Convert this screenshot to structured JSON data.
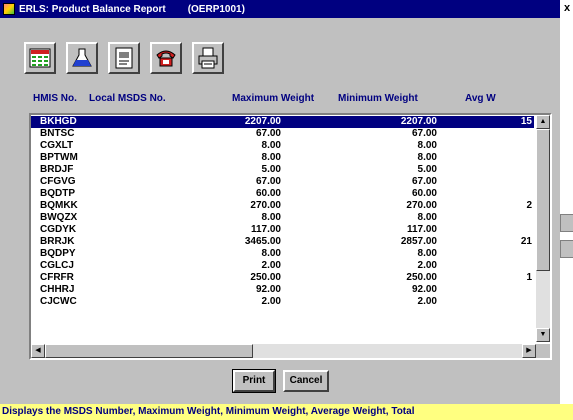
{
  "window": {
    "title": "ERLS: Product Balance Report",
    "code": "(OERP1001)",
    "close_glyph": "x"
  },
  "toolbar": {
    "buttons": [
      {
        "name": "spreadsheet-icon",
        "color": "#d02020"
      },
      {
        "name": "flask-icon",
        "color": "#2040d0"
      },
      {
        "name": "document-icon",
        "color": "#808080"
      },
      {
        "name": "telephone-icon",
        "color": "#d02020"
      },
      {
        "name": "printer-icon",
        "color": "#808080"
      }
    ]
  },
  "columns": [
    "HMIS No.",
    "Local MSDS No.",
    "Maximum Weight",
    "Minimum Weight",
    "Avg W"
  ],
  "rows": [
    {
      "id": "BKHGD",
      "max": "2207.00",
      "min": "2207.00",
      "avg": "15",
      "selected": true
    },
    {
      "id": "BNTSC",
      "max": "67.00",
      "min": "67.00",
      "avg": ""
    },
    {
      "id": "CGXLT",
      "max": "8.00",
      "min": "8.00",
      "avg": ""
    },
    {
      "id": "BPTWM",
      "max": "8.00",
      "min": "8.00",
      "avg": ""
    },
    {
      "id": "BRDJF",
      "max": "5.00",
      "min": "5.00",
      "avg": ""
    },
    {
      "id": "CFGVG",
      "max": "67.00",
      "min": "67.00",
      "avg": ""
    },
    {
      "id": "BQDTP",
      "max": "60.00",
      "min": "60.00",
      "avg": ""
    },
    {
      "id": "BQMKK",
      "max": "270.00",
      "min": "270.00",
      "avg": "2"
    },
    {
      "id": "BWQZX",
      "max": "8.00",
      "min": "8.00",
      "avg": ""
    },
    {
      "id": "CGDYK",
      "max": "117.00",
      "min": "117.00",
      "avg": ""
    },
    {
      "id": "BRRJK",
      "max": "3465.00",
      "min": "2857.00",
      "avg": "21"
    },
    {
      "id": "BQDPY",
      "max": "8.00",
      "min": "8.00",
      "avg": ""
    },
    {
      "id": "CGLCJ",
      "max": "2.00",
      "min": "2.00",
      "avg": ""
    },
    {
      "id": "CFRFR",
      "max": "250.00",
      "min": "250.00",
      "avg": "1"
    },
    {
      "id": "CHHRJ",
      "max": "92.00",
      "min": "92.00",
      "avg": ""
    },
    {
      "id": "CJCWC",
      "max": "2.00",
      "min": "2.00",
      "avg": ""
    }
  ],
  "buttons": {
    "print": "Print",
    "cancel": "Cancel"
  },
  "status": "Displays the MSDS Number, Maximum Weight, Minimum Weight, Average Weight, Total",
  "colors": {
    "title_bar": "#000080",
    "header_text": "#000080",
    "status_bg": "#ffff80",
    "selection": "#000080"
  }
}
